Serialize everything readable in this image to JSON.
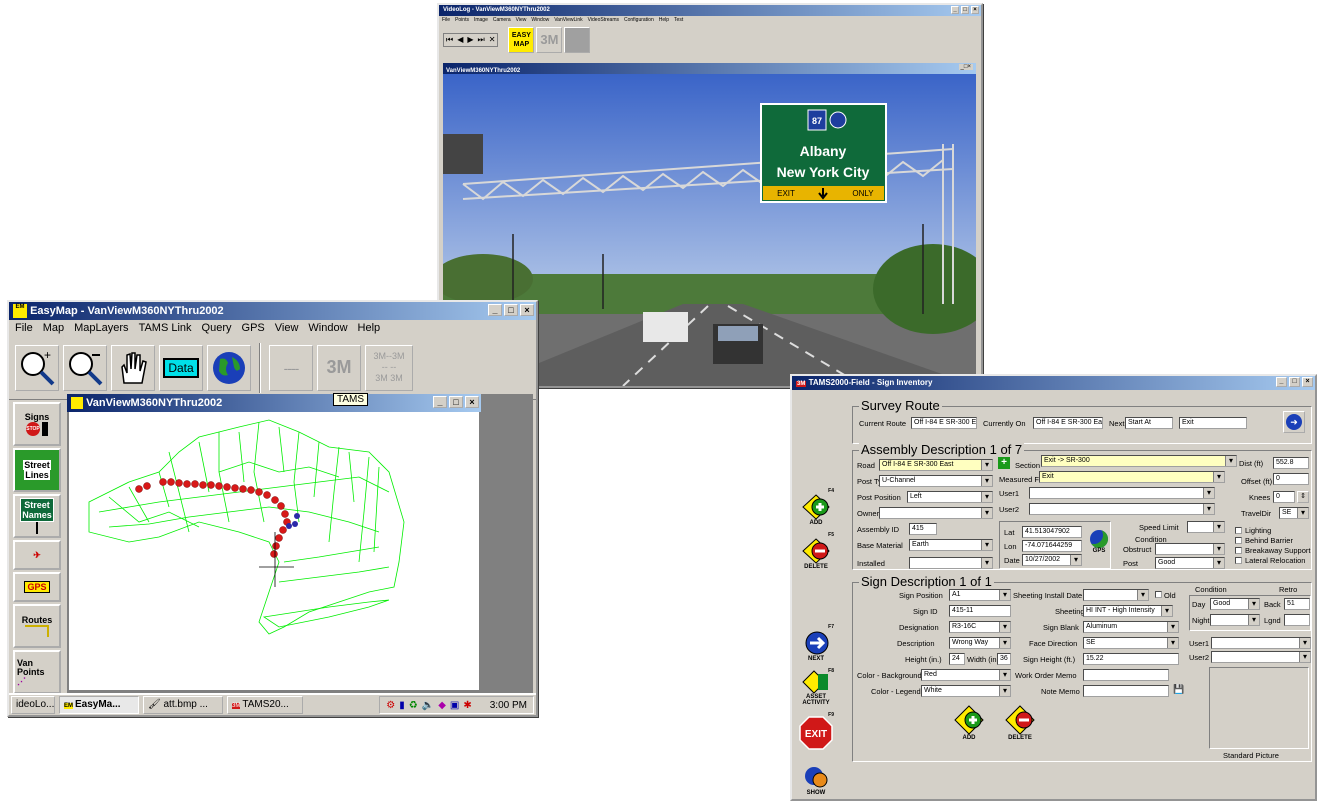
{
  "video": {
    "title": "VideoLog - VanViewM360NYThru2002",
    "menu": [
      "File",
      "Points",
      "Image",
      "Camera",
      "View",
      "Window",
      "VanViewLink",
      "VideoStreams",
      "Configuration",
      "Help",
      "Test"
    ],
    "toolbar": {
      "easymap_label": "EASY MAP",
      "3m_label": "3M"
    },
    "inner_title": "VanViewM360NYThru2002",
    "sign": {
      "route": "87",
      "line1": "Albany",
      "line2": "New York City",
      "exit": "EXIT",
      "only": "ONLY"
    }
  },
  "easymap": {
    "title": "EasyMap - VanViewM360NYThru2002",
    "menu": [
      "File",
      "Map",
      "MapLayers",
      "TAMS Link",
      "Query",
      "GPS",
      "View",
      "Window",
      "Help"
    ],
    "toolbar": {
      "data_label": "Data",
      "3m_label": "3M",
      "3m_dashes": "3M--3M",
      "3m_mid": "--   --",
      "3m_bottom": "3M    3M"
    },
    "sidebar": {
      "signs": "Signs",
      "stop": "STOP",
      "street_lines_1": "Street",
      "street_lines_2": "Lines",
      "street_names_1": "Street",
      "street_names_2": "Names",
      "gps": "GPS",
      "routes": "Routes",
      "van_points_1": "Van",
      "van_points_2": "Points"
    },
    "map_title": "VanViewM360NYThru2002",
    "tooltip": "TAMS",
    "taskbar": {
      "task1": "ideoLo...",
      "task2": "EasyMa...",
      "task3": "att.bmp ...",
      "task4": "TAMS20...",
      "clock": "3:00 PM"
    }
  },
  "tams": {
    "title": "TAMS2000-Field - Sign Inventory",
    "survey": {
      "heading": "Survey Route",
      "current_route_label": "Current Route",
      "current_route": "Off I-84 E SR-300 E",
      "currently_on_label": "Currently On",
      "currently_on": "Off I-84 E SR-300 Ea",
      "next_label": "Next",
      "next": "Start At",
      "exit": "Exit"
    },
    "assembly": {
      "heading": "Assembly Description  1 of 7",
      "road_label": "Road",
      "road": "Off I-84 E SR-300 East",
      "section_label": "Section",
      "section": "Exit -> SR-300",
      "post_type_label": "Post Type",
      "post_type": "U-Channel",
      "measured_from_label": "Measured From",
      "measured_from": "Exit",
      "post_position_label": "Post Position",
      "post_position": "Left",
      "user1_label": "User1",
      "user2_label": "User2",
      "owner_label": "Owner",
      "dist_label": "Dist (ft)",
      "dist": "552.8",
      "offset_label": "Offset (ft)",
      "offset": "0",
      "knees_label": "Knees",
      "knees": "0",
      "travel_dir_label": "TravelDir",
      "travel_dir": "SE",
      "assembly_id_label": "Assembly ID",
      "assembly_id": "415",
      "base_material_label": "Base Material",
      "base_material": "Earth",
      "installed_label": "Installed",
      "lat_label": "Lat",
      "lat": "41.513047902",
      "lon_label": "Lon",
      "lon": "-74.071644259",
      "date_label": "Date",
      "date": "10/27/2002",
      "gps_label": "GPS",
      "speed_limit_label": "Speed Limit",
      "condition_label": "Condition",
      "obstruct_label": "Obstruct",
      "post_label": "Post",
      "post": "Good",
      "lighting": "Lighting",
      "behind_barrier": "Behind Barrier",
      "breakaway": "Breakaway Support",
      "lateral": "Lateral Relocation"
    },
    "sign": {
      "heading": "Sign Description  1 of 1",
      "sign_position_label": "Sign Position",
      "sign_position": "A1",
      "sign_id_label": "Sign ID",
      "sign_id": "415-11",
      "designation_label": "Designation",
      "designation": "R3-16C",
      "description_label": "Description",
      "description": "Wrong Way",
      "height_label": "Height (in.)",
      "height": "24",
      "width_label": "Width (in.)",
      "width": "36",
      "color_bg_label": "Color - Background",
      "color_bg": "Red",
      "color_legend_label": "Color - Legend",
      "color_legend": "White",
      "sheeting_date_label": "Sheeting Install Date",
      "old_label": "Old",
      "sheeting_label": "Sheeting",
      "sheeting": "HI INT - High Intensity",
      "sign_blank_label": "Sign Blank",
      "sign_blank": "Aluminum",
      "face_direction_label": "Face Direction",
      "face_direction": "SE",
      "sign_height_label": "Sign Height (ft.)",
      "sign_height": "15.22",
      "work_order_label": "Work Order Memo",
      "note_memo_label": "Note Memo",
      "condition_label": "Condition",
      "retro_label": "Retro",
      "day_label": "Day",
      "day": "Good",
      "back_label": "Back",
      "back": "51",
      "night_label": "Night",
      "lgnd_label": "Lgnd",
      "user1_label": "User1",
      "user2_label": "User2",
      "standard_picture": "Standard Picture",
      "add": "ADD",
      "delete": "DELETE"
    },
    "side": {
      "f4": "F4",
      "add": "ADD",
      "f5": "F5",
      "delete": "DELETE",
      "f7": "F7",
      "next": "NEXT",
      "f8": "F8",
      "asset_activity": "ASSET ACTIVITY",
      "f9": "F9",
      "exit": "EXIT",
      "show": "SHOW"
    }
  }
}
